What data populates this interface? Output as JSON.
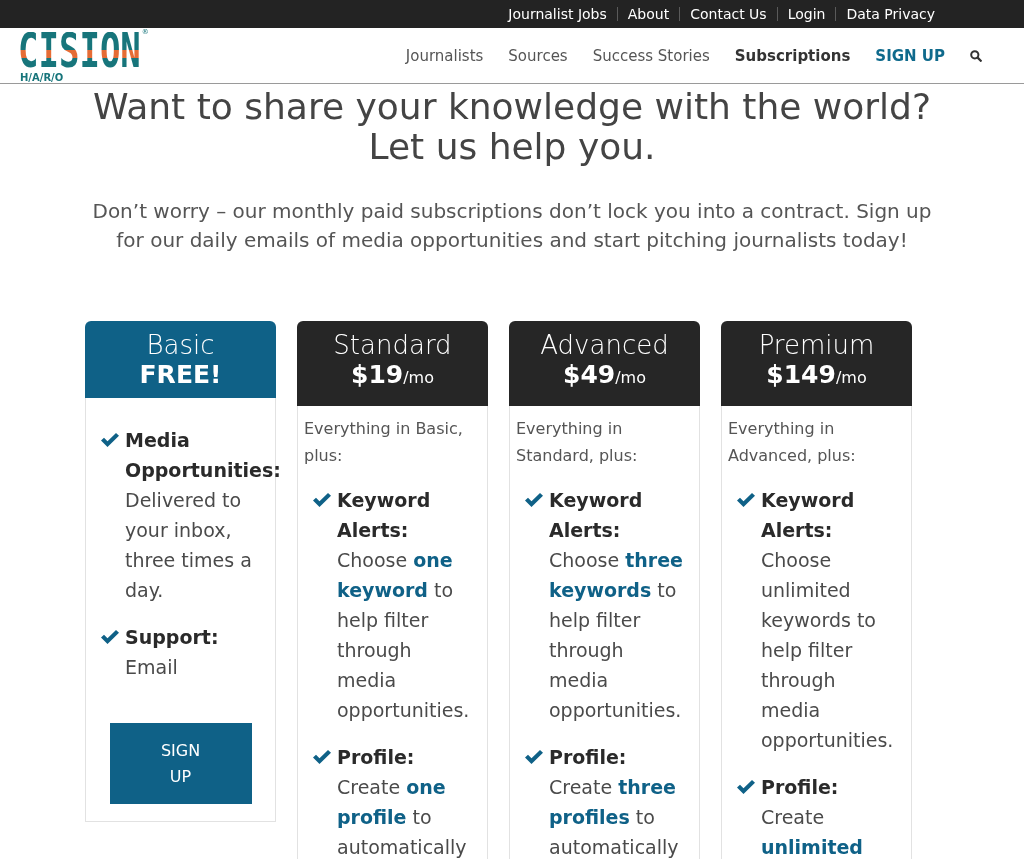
{
  "top_bar": {
    "links": [
      "Journalist Jobs",
      "About",
      "Contact Us",
      "Login",
      "Data Privacy"
    ]
  },
  "header": {
    "logo": {
      "wordmark": "CISION",
      "registered_mark": "®",
      "tagline": "H/A/R/O"
    },
    "nav": [
      {
        "label": "Journalists",
        "kind": "link",
        "selected": false
      },
      {
        "label": "Sources",
        "kind": "link",
        "selected": false
      },
      {
        "label": "Success Stories",
        "kind": "link",
        "selected": false
      },
      {
        "label": "Subscriptions",
        "kind": "link",
        "selected": true
      },
      {
        "label": "SIGN UP",
        "kind": "cta",
        "selected": false
      }
    ]
  },
  "hero": {
    "title": "Want to share your knowledge with the world? Let us help you.",
    "subtitle": "Don’t worry – our monthly paid subscriptions don’t lock you into a contract. Sign up for our daily emails of media opportunities and start pitching journalists today!"
  },
  "plans": [
    {
      "name": "Basic",
      "price": "FREE!",
      "featured": true,
      "features": [
        {
          "title": "Media Opportunities:",
          "text": "Delivered to your inbox, three times a day."
        },
        {
          "title": "Support:",
          "text": "Email"
        }
      ],
      "button": "SIGN UP"
    },
    {
      "name": "Standard",
      "price": "$19",
      "period": "/mo",
      "featured": false,
      "intro": "Everything in Basic, plus:",
      "features": [
        {
          "title": "Keyword Alerts:",
          "text": "Choose **one keyword** to help filter through media opportunities."
        },
        {
          "title": "Profile:",
          "text": "Create **one profile** to automatically"
        }
      ]
    },
    {
      "name": "Advanced",
      "price": "$49",
      "period": "/mo",
      "featured": false,
      "intro": "Everything in Standard, plus:",
      "features": [
        {
          "title": "Keyword Alerts:",
          "text": "Choose **three keywords** to help filter through media opportunities."
        },
        {
          "title": "Profile:",
          "text": "Create **three profiles** to automatically"
        }
      ]
    },
    {
      "name": "Premium",
      "price": "$149",
      "period": "/mo",
      "featured": false,
      "intro": "Everything in Advanced, plus:",
      "features": [
        {
          "title": "Keyword Alerts:",
          "text": "Choose unlimited keywords to help filter through media opportunities."
        },
        {
          "title": "Profile:",
          "text": "Create **unlimited**"
        }
      ]
    }
  ]
}
